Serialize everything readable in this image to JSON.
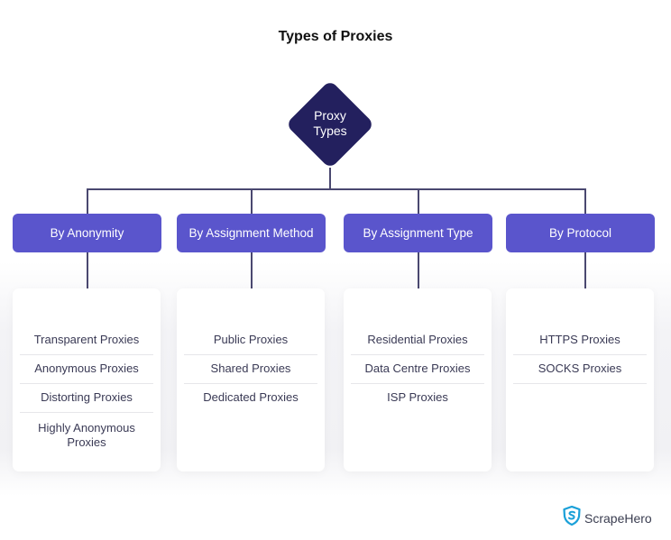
{
  "title": "Types of Proxies",
  "root": {
    "line1": "Proxy",
    "line2": "Types",
    "color": "#23205e"
  },
  "category_color": "#5a55cc",
  "categories": [
    {
      "label": "By Anonymity",
      "items": [
        "Transparent Proxies",
        "Anonymous Proxies",
        "Distorting Proxies",
        "Highly Anonymous Proxies"
      ]
    },
    {
      "label": "By Assignment Method",
      "items": [
        "Public Proxies",
        "Shared Proxies",
        "Dedicated Proxies"
      ]
    },
    {
      "label": "By Assignment Type",
      "items": [
        "Residential Proxies",
        "Data Centre Proxies",
        "ISP Proxies"
      ]
    },
    {
      "label": "By Protocol",
      "items": [
        "HTTPS Proxies",
        "SOCKS Proxies"
      ]
    }
  ],
  "brand": {
    "name": "ScrapeHero",
    "icon": "shield-s-logo-icon",
    "color": "#1aa0d8"
  }
}
